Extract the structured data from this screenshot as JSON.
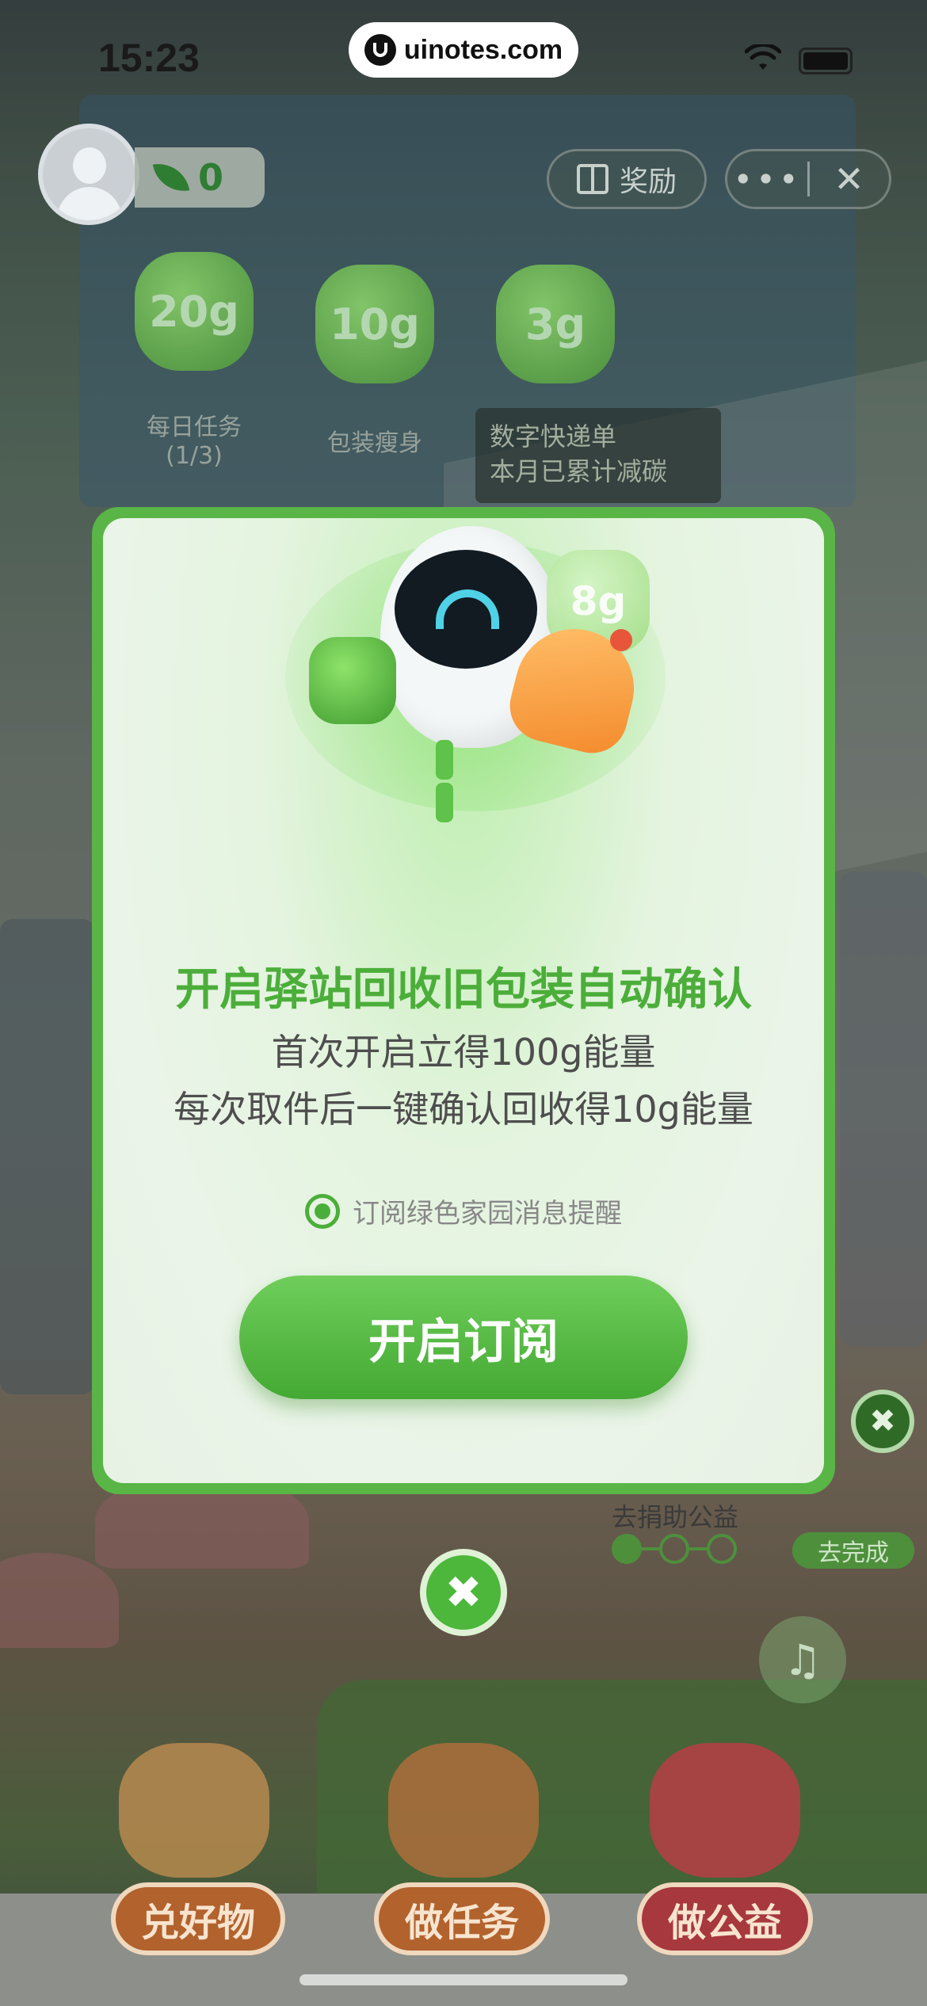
{
  "status_bar": {
    "time": "15:23",
    "url": "uinotes.com"
  },
  "hud": {
    "energy": "0",
    "reward_label": "奖励",
    "menu_dots": "•••",
    "close_symbol": "✕"
  },
  "energy_bubbles": [
    {
      "amount": "20g",
      "label": "每日任务",
      "sub": "(1/3)"
    },
    {
      "amount": "10g",
      "label": "包装瘦身",
      "sub": ""
    },
    {
      "amount": "3g",
      "label": "",
      "sub": ""
    }
  ],
  "tracker": {
    "line1": "数字快递单",
    "line2": "本月已累计减碳"
  },
  "modal": {
    "title": "开启驿站回收旧包装自动确认",
    "line1": "首次开启立得100g能量",
    "line2": "每次取件后一键确认回收得10g能量",
    "subscribe_label": "订阅绿色家园消息提醒",
    "cta_label": "开启订阅",
    "badge_amount": "8g",
    "close_symbol": "✖"
  },
  "task_strip": {
    "label": "去捐助公益",
    "button": "去完成",
    "progress": {
      "done": 1,
      "total": 3
    }
  },
  "side_close_symbol": "✖",
  "bottom_nav": [
    {
      "label": "兑好物",
      "icon": "shop-icon"
    },
    {
      "label": "做任务",
      "icon": "task-calendar-icon"
    },
    {
      "label": "做公益",
      "icon": "heart-icon"
    }
  ],
  "colors": {
    "accent_green": "#4cae3a",
    "modal_border": "#59b546",
    "title_green": "#4cae3a"
  }
}
